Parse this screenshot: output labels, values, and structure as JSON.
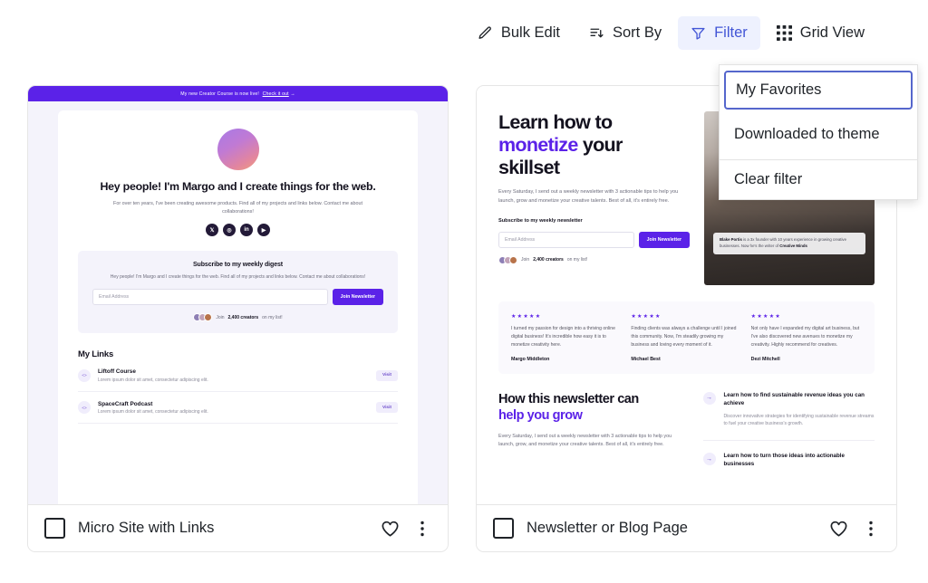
{
  "toolbar": {
    "buttons": [
      {
        "label": "Bulk Edit",
        "icon": "pencil-icon",
        "active": false
      },
      {
        "label": "Sort By",
        "icon": "sort-descending-icon",
        "active": false
      },
      {
        "label": "Filter",
        "icon": "funnel-icon",
        "active": true
      },
      {
        "label": "Grid View",
        "icon": "grid-icon",
        "active": false
      }
    ]
  },
  "filter_menu": {
    "items": [
      {
        "label": "My Favorites",
        "selected": true
      },
      {
        "label": "Downloaded to theme",
        "selected": false
      }
    ],
    "clear_label": "Clear filter"
  },
  "colors": {
    "accent_purple": "#5b22e8",
    "toolbar_active_text": "#4356d6",
    "toolbar_active_bg": "#eef1fe",
    "menu_selected_border": "#5566cc"
  },
  "cards": [
    {
      "title": "Micro Site with Links",
      "favorite_icon": "heart-icon",
      "menu_icon": "more-vertical-icon",
      "checkbox_checked": false,
      "preview": {
        "banner": {
          "text": "My new Creator Course is now live!",
          "link": "Check it out",
          "arrow": "→"
        },
        "heading": "Hey people! I'm Margo and I create things for the web.",
        "subtext": "For over ten years, I've been creating awesome products. Find all of my projects and links below. Contact me about collaborations!",
        "socials": [
          "x-icon",
          "instagram-icon",
          "linkedin-icon",
          "youtube-icon"
        ],
        "digest": {
          "heading": "Subscribe to my weekly digest",
          "text": "Hey people! I'm Margo and I create things for the web. Find all of my projects and links below. Contact me about collaborations!",
          "input_placeholder": "Email Address",
          "button": "Join Newsletter",
          "creators_prefix": "Join",
          "creators_count": "2,400 creators",
          "creators_suffix": "on my list!"
        },
        "links_heading": "My Links",
        "links": [
          {
            "title": "Liftoff Course",
            "desc": "Lorem ipsum dolor sit amet, consectetur adipiscing elit.",
            "action": "Visit"
          },
          {
            "title": "SpaceCraft Podcast",
            "desc": "Lorem ipsum dolor sit amet, consectetur adipiscing elit.",
            "action": "Visit"
          }
        ]
      }
    },
    {
      "title": "Newsletter or Blog Page",
      "favorite_icon": "heart-icon",
      "menu_icon": "more-vertical-icon",
      "checkbox_checked": false,
      "preview": {
        "heading_line1": "Learn how to",
        "heading_accent": "monetize",
        "heading_line2_rest": " your",
        "heading_line3": "skillset",
        "intro": "Every Saturday, I send out a weekly newsletter with 3 actionable tips to help you launch, grow and monetize your creative talents. Best of all, it's entirely free.",
        "subscribe_label": "Subscribe to my weekly newsletter",
        "input_placeholder": "Email Address",
        "button": "Join Newsletter",
        "creators_prefix": "Join",
        "creators_count": "2,400 creators",
        "creators_suffix": "on my list!",
        "photo_caption_name": "Blake Portis",
        "photo_caption_rest": " is a 3x founder with 10 years experience in growing creative businesses. Now he's the writer of ",
        "photo_caption_brand": "Creative Minds",
        "testimonials": [
          {
            "stars": "★★★★★",
            "text": "I turned my passion for design into a thriving online digital business! It's incredible how easy it is to monetize creativity here.",
            "name": "Margo Middleton"
          },
          {
            "stars": "★★★★★",
            "text": "Finding clients was always a challenge until I joined this community. Now, I'm steadily growing my business and loving every moment of it.",
            "name": "Michael Best"
          },
          {
            "stars": "★★★★★",
            "text": "Not only have I expanded my digital art business, but I've also discovered new avenues to monetize my creativity. Highly recommend for creatives.",
            "name": "Dezi Mitchell"
          }
        ],
        "grow_heading_line1": "How this newsletter can",
        "grow_heading_accent": "help you grow",
        "grow_text": "Every Saturday, I send out a weekly newsletter with 3 actionable tips to help you launch, grow, and monetize your creative talents. Best of all, it's entirely free.",
        "grow_items": [
          {
            "title": "Learn how to find sustainable revenue ideas you can achieve",
            "desc": "Discover innovative strategies for identifying sustainable revenue streams to fuel your creative business's growth."
          },
          {
            "title": "Learn how to turn those ideas into actionable businesses",
            "desc": ""
          }
        ]
      }
    }
  ]
}
